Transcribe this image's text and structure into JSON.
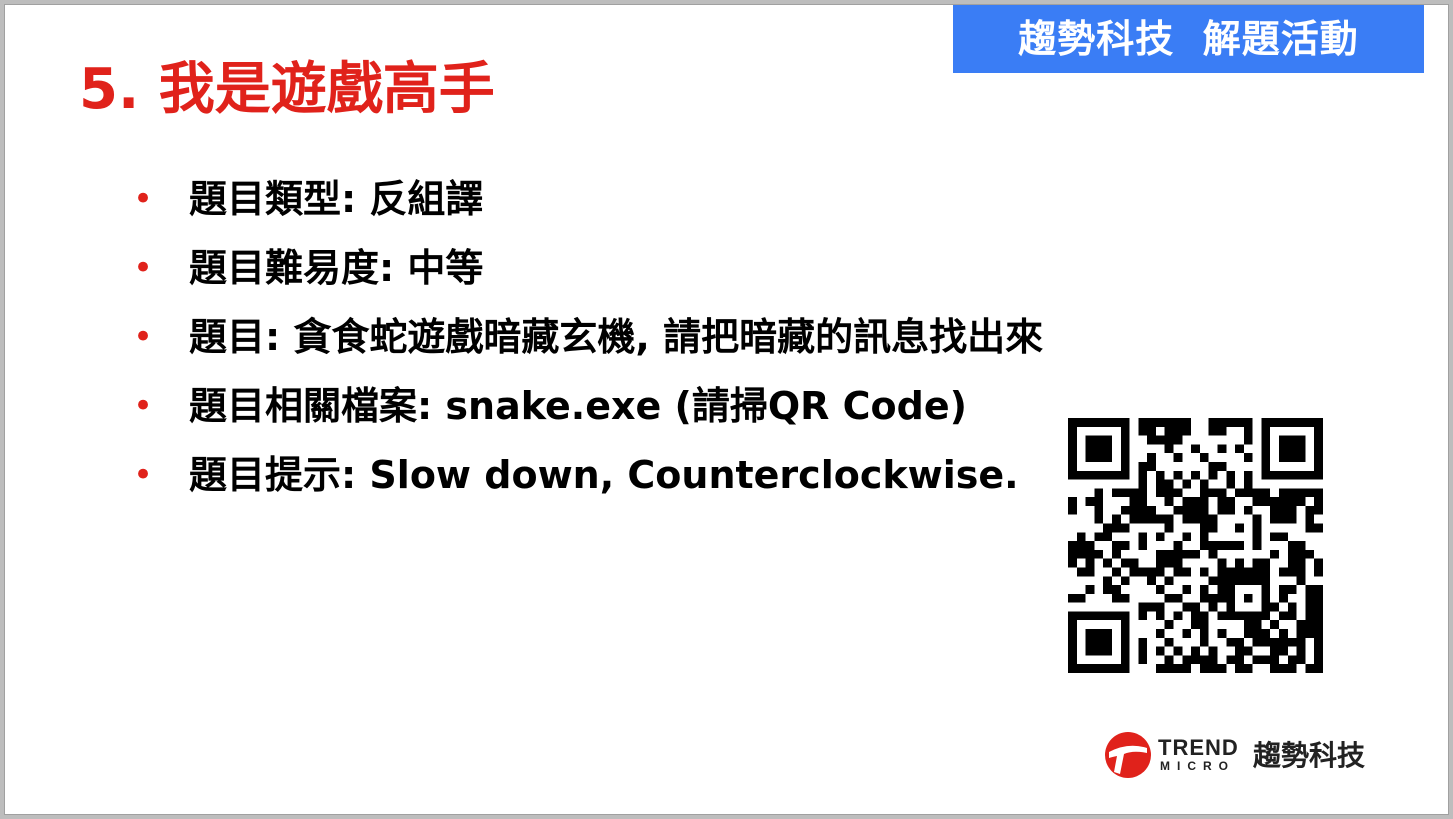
{
  "banner": {
    "text": "趨勢科技  解題活動",
    "bg_color": "#3a7df5"
  },
  "title": "5. 我是遊戲高手",
  "accent_color": "#e0221b",
  "bullets": [
    {
      "text": "題目類型: 反組譯"
    },
    {
      "text": "題目難易度: 中等"
    },
    {
      "text": "題目:  貪食蛇遊戲暗藏玄機, 請把暗藏的訊息找出來"
    },
    {
      "text": "題目相關檔案:  snake.exe (請掃QR Code)"
    },
    {
      "text": "題目提示:  Slow down, Counterclockwise."
    }
  ],
  "bullet_glyph": "•",
  "qr": {
    "icon": "qr-code-icon"
  },
  "logo": {
    "icon": "trend-micro-logo-icon",
    "brand_line1": "TREND",
    "brand_line2": "MICRO",
    "name_cn": "趨勢科技"
  }
}
